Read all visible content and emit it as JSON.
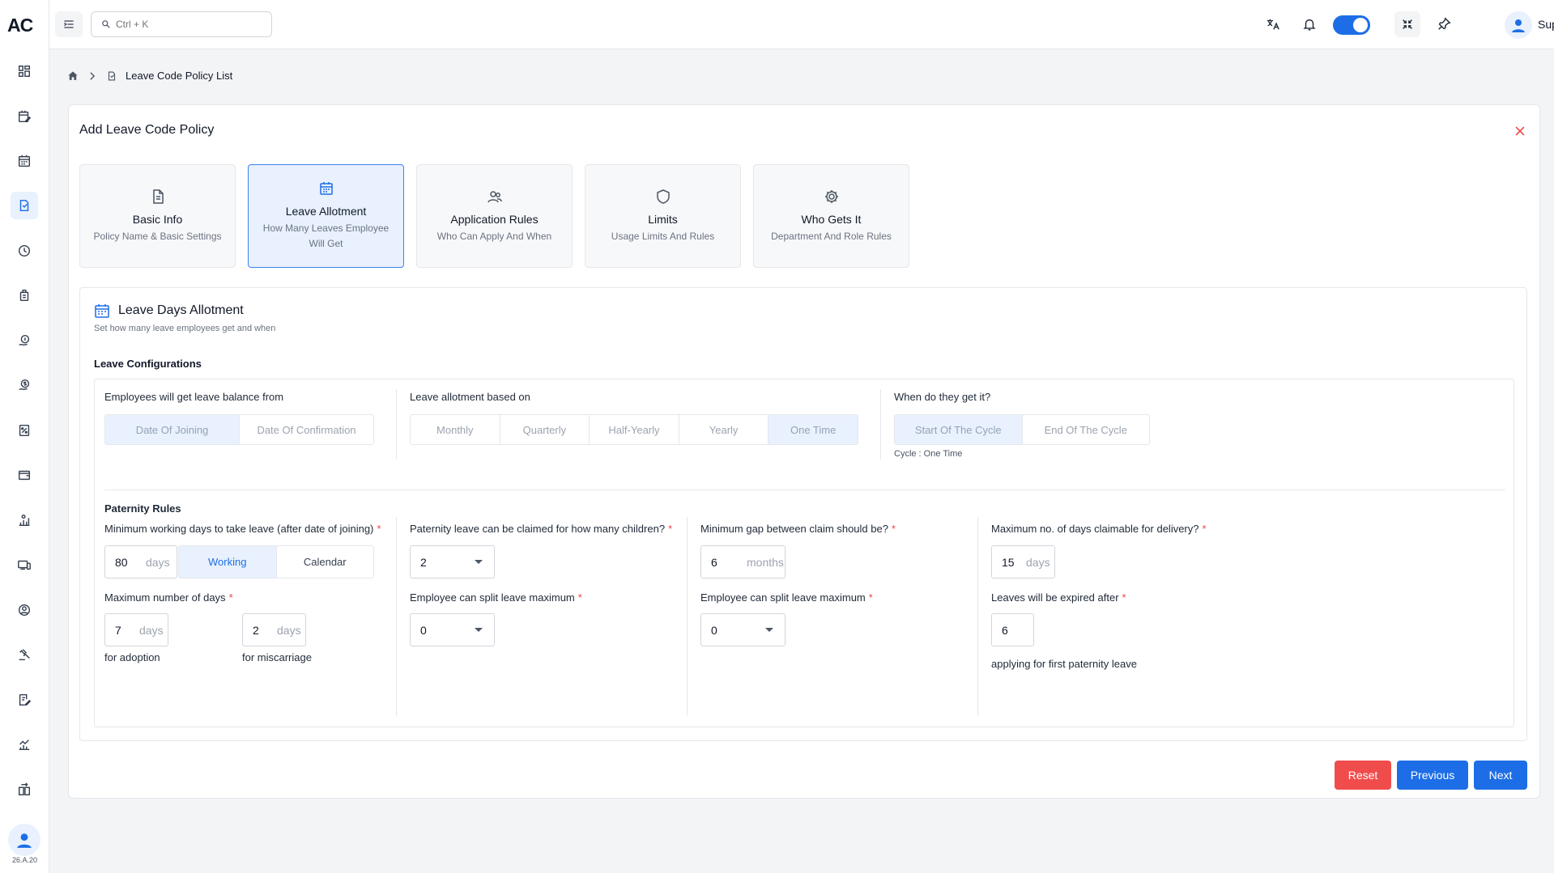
{
  "app": {
    "logo": "AC",
    "version": "26.A.20"
  },
  "topbar": {
    "search_placeholder": "Ctrl + K",
    "user_name": "Support"
  },
  "breadcrumb": {
    "current": "Leave Code Policy List"
  },
  "card": {
    "title": "Add Leave Code Policy"
  },
  "steps": [
    {
      "title": "Basic Info",
      "sub": "Policy Name & Basic Settings"
    },
    {
      "title": "Leave Allotment",
      "sub": "How Many Leaves Employee Will Get"
    },
    {
      "title": "Application Rules",
      "sub": "Who Can Apply And When"
    },
    {
      "title": "Limits",
      "sub": "Usage Limits And Rules"
    },
    {
      "title": "Who Gets It",
      "sub": "Department And Role Rules"
    }
  ],
  "section": {
    "title": "Leave Days Allotment",
    "subtitle": "Set how many leave employees get and when",
    "config_label": "Leave Configurations"
  },
  "config": {
    "balance_from": {
      "label": "Employees will get leave balance from",
      "options": [
        "Date Of Joining",
        "Date Of Confirmation"
      ],
      "selected": "Date Of Joining"
    },
    "allotment": {
      "label": "Leave allotment based on",
      "options": [
        "Monthly",
        "Quarterly",
        "Half-Yearly",
        "Yearly",
        "One Time"
      ],
      "selected": "One Time"
    },
    "when": {
      "label": "When do they get it?",
      "options": [
        "Start Of The Cycle",
        "End Of The Cycle"
      ],
      "selected": "Start Of The Cycle",
      "note": "Cycle : One Time"
    }
  },
  "paternity": {
    "title": "Paternity Rules",
    "min_working": {
      "label": "Minimum working days to take leave (after date of joining)",
      "value": "80",
      "unit": "days",
      "options": [
        "Working",
        "Calendar"
      ],
      "selected": "Working"
    },
    "children": {
      "label": "Paternity leave can be claimed for how many children?",
      "value": "2"
    },
    "gap": {
      "label": "Minimum gap between claim should be?",
      "value": "6",
      "unit": "months"
    },
    "delivery": {
      "label": "Maximum no. of days claimable for delivery?",
      "value": "15",
      "unit": "days"
    },
    "max_days": {
      "label": "Maximum number of days",
      "adoption": {
        "value": "7",
        "unit": "days",
        "label": "for adoption"
      },
      "miscarriage": {
        "value": "2",
        "unit": "days",
        "label": "for miscarriage"
      }
    },
    "split1": {
      "label": "Employee can split leave maximum",
      "value": "0"
    },
    "split2": {
      "label": "Employee can split leave maximum",
      "value": "0"
    },
    "expire": {
      "label": "Leaves will be expired after",
      "value": "6",
      "note": "applying for first paternity leave"
    }
  },
  "buttons": {
    "reset": "Reset",
    "previous": "Previous",
    "next": "Next"
  },
  "colors": {
    "primary": "#1d6ee6",
    "danger": "#f04c4c",
    "selected_bg": "#e8f1fd"
  }
}
